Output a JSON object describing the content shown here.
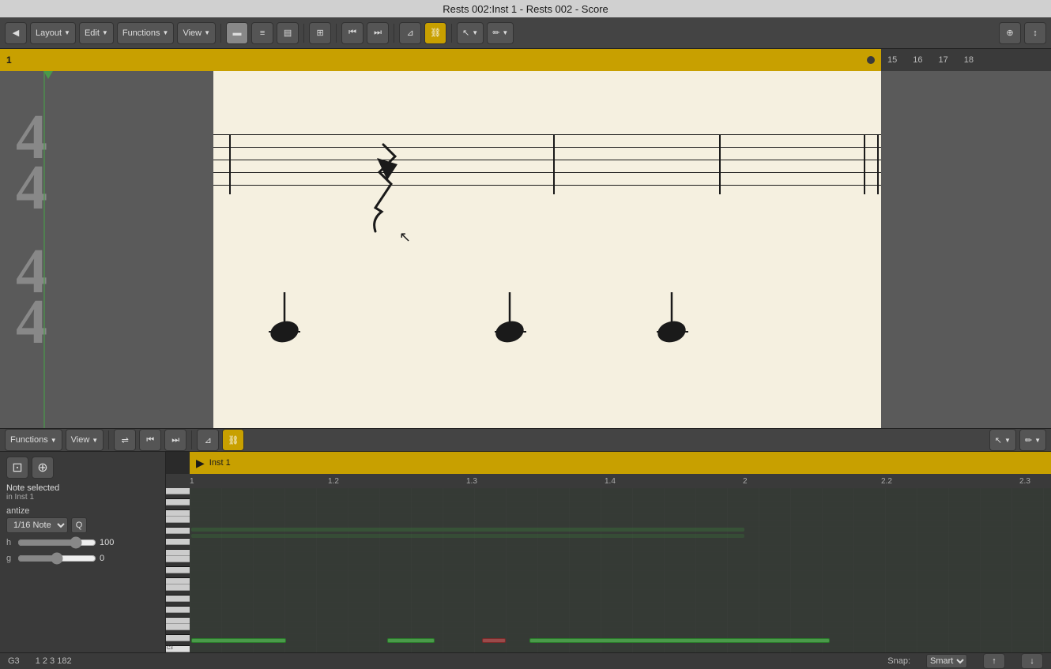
{
  "titleBar": {
    "title": "Rests 002:Inst 1 - Rests 002 - Score"
  },
  "topToolbar": {
    "back_label": "◀",
    "layout_label": "Layout",
    "edit_label": "Edit",
    "functions_label": "Functions",
    "view_label": "View",
    "arrow": "▼"
  },
  "rightRuler": {
    "nums": [
      "15",
      "16",
      "17",
      "18"
    ]
  },
  "scoreRuler": {
    "marker": "1"
  },
  "bottomToolbar": {
    "functions_label": "Functions",
    "view_label": "View"
  },
  "noteInfo": {
    "selected": "Note selected",
    "in_inst": "in Inst 1"
  },
  "quantize": {
    "label": "antize",
    "value": "1/16 Note",
    "q_btn": "Q"
  },
  "sliders": {
    "h_label": "h",
    "h_value": "100",
    "g_label": "g",
    "g_value": "0"
  },
  "infoBar": {
    "note": "G3",
    "position": "1 2 3 182",
    "snap_label": "Snap:",
    "snap_value": "Smart"
  },
  "rollHeader": {
    "track_name": "Inst 1",
    "play_symbol": "▶"
  },
  "pianoKeys": {
    "c3_label": "C3"
  }
}
